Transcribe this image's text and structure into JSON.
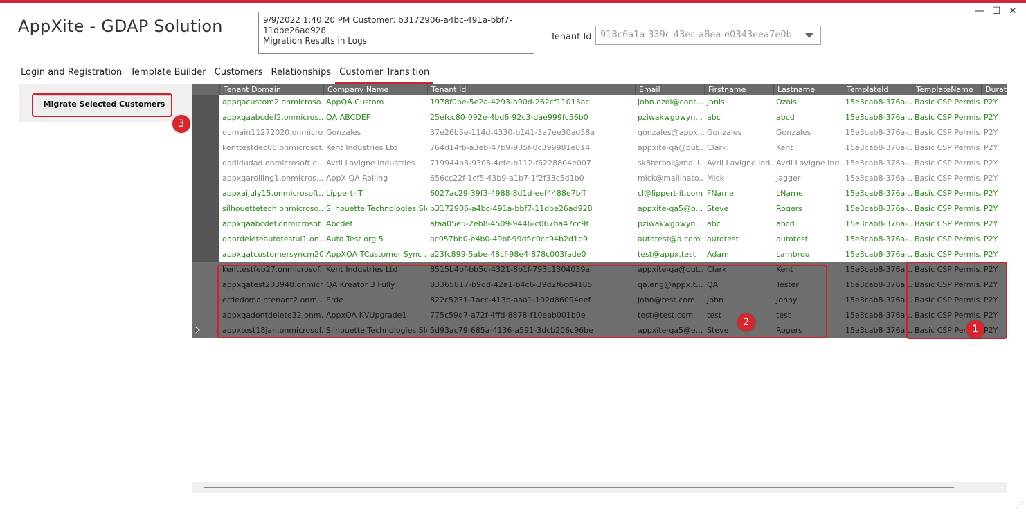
{
  "app": {
    "title": "AppXite - GDAP Solution",
    "window_controls": {
      "minimize": "—",
      "maximize": "☐",
      "close": "✕"
    }
  },
  "log": {
    "line1": "9/9/2022 1:40:20 PM Customer: b3172906-a4bc-491a-bbf7-11dbe26ad928",
    "line2": "Migration Results in Logs"
  },
  "tenant": {
    "label": "Tenant Id:",
    "value": "918c6a1a-339c-43ec-a8ea-e0343eea7e0b"
  },
  "tabs": [
    {
      "label": "Login and Registration",
      "active": false
    },
    {
      "label": "Template Builder",
      "active": false
    },
    {
      "label": "Customers",
      "active": false
    },
    {
      "label": "Relationships",
      "active": false
    },
    {
      "label": "Customer Transition",
      "active": true
    }
  ],
  "side": {
    "migrate_label": "Migrate Selected Customers"
  },
  "annotations": {
    "badge1": "1",
    "badge2": "2",
    "badge3": "3"
  },
  "grid": {
    "columns": [
      "Tenant Domain",
      "Company Name",
      "Tenant Id",
      "Email",
      "Firstname",
      "Lastname",
      "TemplateId",
      "TemplateName",
      "Durati"
    ],
    "rows": [
      {
        "style": "green",
        "cells": [
          "appqacustom2.onmicroso...",
          "AppQA Custom",
          "1978f0be-5e2a-4293-a90d-262cf11013ac",
          "john.ozol@cont...",
          "Janis",
          "Ozols",
          "15e3cab8-376a-...",
          "Basic CSP Permis...",
          "P2Y"
        ]
      },
      {
        "style": "green",
        "cells": [
          "appxqaabcdef2.onmicros...",
          "QA ABCDEF",
          "25efcc80-092e-4bd6-92c3-dae999fc56b0",
          "pziwakwgbwyn...",
          "abc",
          "abcd",
          "15e3cab8-376a-...",
          "Basic CSP Permis...",
          "P2Y"
        ]
      },
      {
        "style": "grey",
        "cells": [
          "domain11272020.onmicro...",
          "Gonzales",
          "37e26b5e-114d-4330-b141-3a7ee30ad58a",
          "gonzales@appx...",
          "Gonzales",
          "Gonzales",
          "15e3cab8-376a-...",
          "Basic CSP Permis...",
          "P2Y"
        ]
      },
      {
        "style": "grey",
        "cells": [
          "kenttestdec06.onmicrosof...",
          "Kent Industries Ltd",
          "764d14fb-a3eb-47b9-935f-0c399981e814",
          "appxite-qa@out...",
          "Clark",
          "Kent",
          "15e3cab8-376a-...",
          "Basic CSP Permis...",
          "P2Y"
        ]
      },
      {
        "style": "grey",
        "cells": [
          "dadidudad.onmicrosoft.c...",
          "Avril Lavigne Industries",
          "719944b3-9308-4efe-b112-f6228804e007",
          "sk8terboi@maili...",
          "Avril Lavigne Ind...",
          "Avril Lavigne Ind...",
          "15e3cab8-376a-...",
          "Basic CSP Permis...",
          "P2Y"
        ]
      },
      {
        "style": "grey",
        "cells": [
          "appxqarolling1.onmicros...",
          "AppX QA Rolling",
          "656cc22f-1cf5-43b9-a1b7-1f2f33c5d1b0",
          "mick@mailinato...",
          "Mick",
          "Jagger",
          "15e3cab8-376a-...",
          "Basic CSP Permis...",
          "P2Y"
        ]
      },
      {
        "style": "green",
        "cells": [
          "appxaijuly15.onmicrosoft....",
          "Lippert-IT",
          "6027ac29-39f3-4988-8d1d-eef4488e7bff",
          "cl@lippert-it.com",
          "FName",
          "LName",
          "15e3cab8-376a-...",
          "Basic CSP Permis...",
          "P2Y"
        ]
      },
      {
        "style": "green",
        "cells": [
          "silhouettetech.onmicroso...",
          "Silhouette Technologies SIA",
          "b3172906-a4bc-491a-bbf7-11dbe26ad928",
          "appxite-qa5@o...",
          "Steve",
          "Rogers",
          "15e3cab8-376a-...",
          "Basic CSP Permis...",
          "P2Y"
        ]
      },
      {
        "style": "green",
        "cells": [
          "appxqaabcdef.onmicrosof...",
          "Abcdef",
          "afaa05e5-2eb8-4509-9446-c067ba47cc9f",
          "pziwakwgbwyn...",
          "abc",
          "abcd",
          "15e3cab8-376a-...",
          "Basic CSP Permis...",
          "P2Y"
        ]
      },
      {
        "style": "green",
        "cells": [
          "dontdeleteautotestui1.on...",
          "Auto Test org 5",
          "ac057bb0-e4b0-49bf-99df-c0cc94b2d1b9",
          "autotest@a.com",
          "autotest",
          "autotest",
          "15e3cab8-376a-...",
          "Basic CSP Permis...",
          "P2Y"
        ]
      },
      {
        "style": "green",
        "cells": [
          "appxqatcustomersyncm20...",
          "AppXQA TCustomer Sync ...",
          "a23fc899-5abe-48cf-98e4-878c003fade0",
          "test@appx.test",
          "Adam",
          "Lambrou",
          "15e3cab8-376a-...",
          "Basic CSP Permis...",
          "P2Y"
        ]
      },
      {
        "style": "nosel",
        "cells": [
          "kenttestfeb27.onmicrosof...",
          "Kent Industries Ltd",
          "8515b4bf-bb5d-4321-8b1f-793c1304039a",
          "appxite-qa@out...",
          "Clark",
          "Kent",
          "15e3cab8-376a-...",
          "Basic CSP Permis...",
          "P2Y"
        ]
      },
      {
        "style": "nosel",
        "cells": [
          "appxqatest203948.onmicr...",
          "QA Kreator 3 Fully",
          "83365817-b9dd-42a1-b4c6-39d2f6cd4185",
          "qa.eng@appx.t...",
          "QA",
          "Tester",
          "15e3cab8-376a-...",
          "Basic CSP Permis...",
          "P2Y"
        ]
      },
      {
        "style": "nosel",
        "cells": [
          "erdedomaintenant2.onmi...",
          "Erde",
          "822c5231-1acc-413b-aaa1-102d86094eef",
          "john@test.com",
          "John",
          "Johny",
          "15e3cab8-376a-...",
          "Basic CSP Permis...",
          "P2Y"
        ]
      },
      {
        "style": "nosel",
        "cells": [
          "appxqadontdelete32.onm...",
          "AppxQA KVUpgrade1",
          "775c59d7-a72f-4ffd-8878-f10eab001b0e",
          "test@test.com",
          "test",
          "test",
          "15e3cab8-376a-...",
          "Basic CSP Permis...",
          "P2Y"
        ]
      },
      {
        "style": "nosel",
        "cells": [
          "appxtest18jan.onmicrosof...",
          "Silhouette Technologies SIA",
          "5d93ac79-685a-4136-a591-3dcb206c96be",
          "appxite-qa5@e...",
          "Steve",
          "Rogers",
          "15e3cab8-376a-...",
          "Basic CSP Permis...",
          "P2Y"
        ]
      }
    ]
  }
}
